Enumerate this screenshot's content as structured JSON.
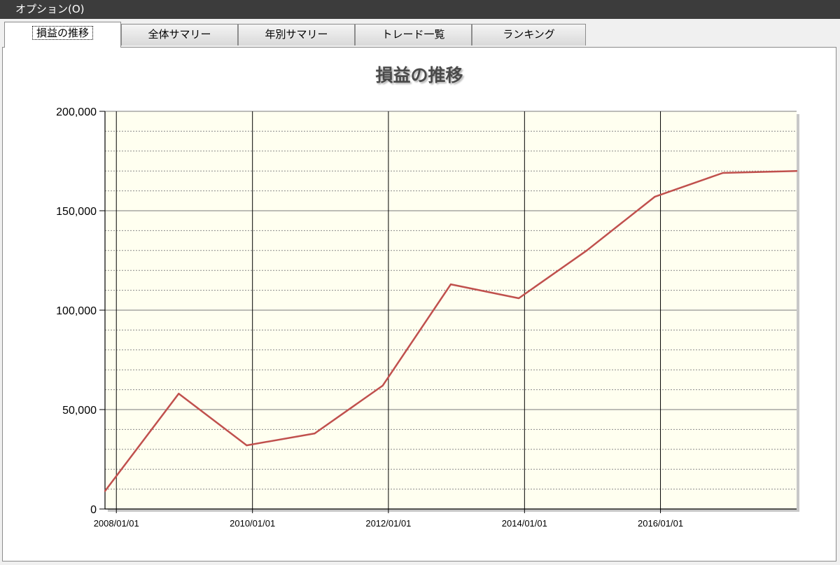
{
  "menubar": {
    "options_label": "オプション(O)"
  },
  "tabs": [
    {
      "label": "損益の推移",
      "active": true
    },
    {
      "label": "全体サマリー",
      "active": false
    },
    {
      "label": "年別サマリー",
      "active": false
    },
    {
      "label": "トレード一覧",
      "active": false
    },
    {
      "label": "ランキング",
      "active": false
    }
  ],
  "chart_data": {
    "type": "line",
    "title": "損益の推移",
    "xlabel": "",
    "ylabel": "",
    "x_tick_labels": [
      "2008/01/01",
      "2010/01/01",
      "2012/01/01",
      "2014/01/01",
      "2016/01/01"
    ],
    "y_tick_labels": [
      "0",
      "50,000",
      "100,000",
      "150,000",
      "200,000"
    ],
    "ylim": [
      0,
      200000
    ],
    "xlim": [
      "2007/11/01",
      "2018/01/01"
    ],
    "grid": true,
    "series": [
      {
        "color": "#c0504d",
        "points": [
          {
            "x": "2007/11/01",
            "y": 9000
          },
          {
            "x": "2008/12/01",
            "y": 58000
          },
          {
            "x": "2009/12/01",
            "y": 32000
          },
          {
            "x": "2010/12/01",
            "y": 38000
          },
          {
            "x": "2011/12/01",
            "y": 62000
          },
          {
            "x": "2012/12/01",
            "y": 113000
          },
          {
            "x": "2013/12/01",
            "y": 106000
          },
          {
            "x": "2014/12/01",
            "y": 130000
          },
          {
            "x": "2015/12/01",
            "y": 157000
          },
          {
            "x": "2016/12/01",
            "y": 169000
          },
          {
            "x": "2018/01/01",
            "y": 170000
          }
        ]
      }
    ],
    "colors": {
      "plot_background": "#fffff0",
      "line": "#c0504d"
    }
  }
}
